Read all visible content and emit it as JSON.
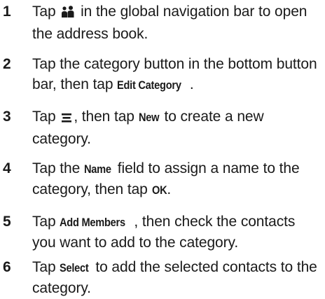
{
  "steps": [
    {
      "number": "1",
      "pre": "Tap",
      "icon": "contacts-icon",
      "post": "in the global navigation bar to open the address book."
    },
    {
      "number": "2",
      "pre": "Tap the category button in the bottom button bar, then tap",
      "keyword": "Edit Category",
      "post": "."
    },
    {
      "number": "3",
      "pre": "Tap",
      "icon": "menu-icon",
      "mid": ", then tap",
      "keyword": "New",
      "post": "to create a new category."
    },
    {
      "number": "4",
      "pre": "Tap the",
      "keyword": "Name",
      "mid": "field to assign a name to the category, then tap",
      "keyword2": "OK",
      "post": "."
    },
    {
      "number": "5",
      "pre": "Tap",
      "keyword": "Add Members",
      "post": ", then check the contacts you want to add to the category."
    },
    {
      "number": "6",
      "pre": "Tap",
      "keyword": "Select",
      "post": "to add the selected contacts to the category."
    }
  ]
}
